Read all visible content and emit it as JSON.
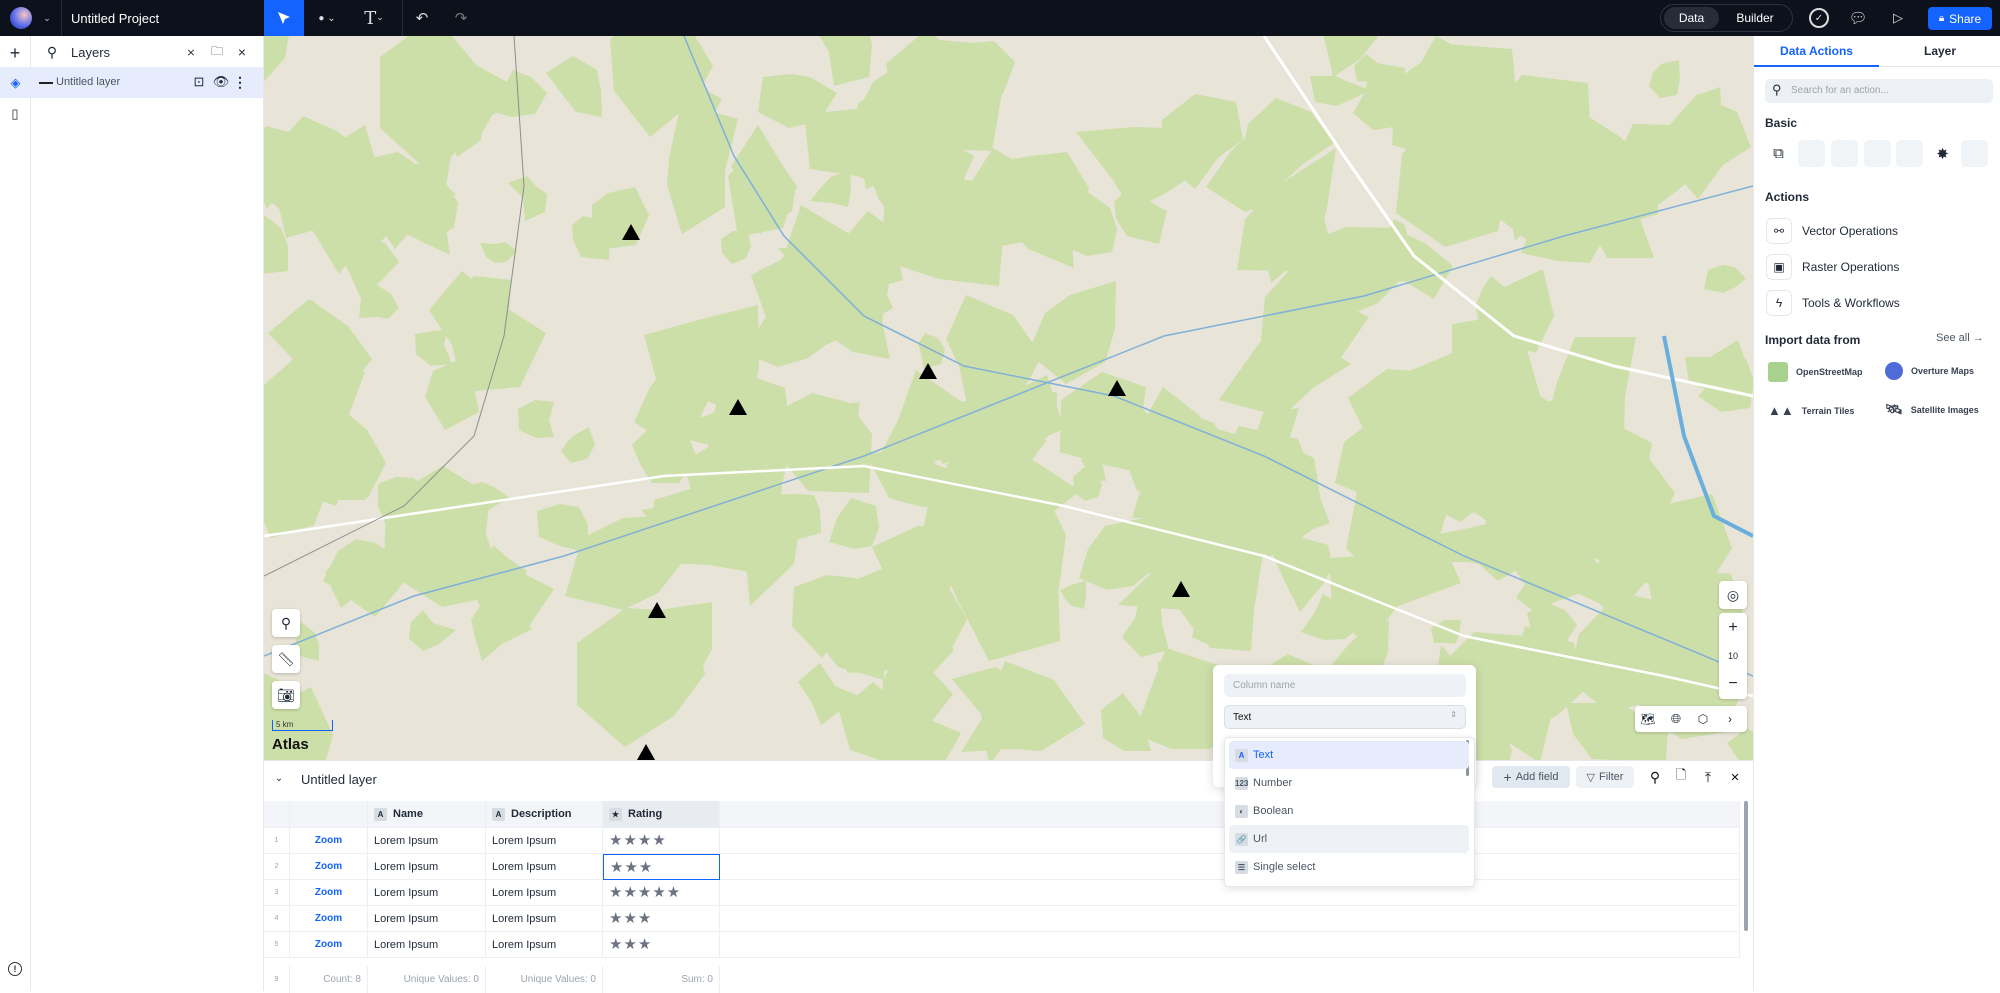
{
  "topbar": {
    "project_title": "Untitled Project",
    "mode_tabs": [
      "Data",
      "Builder"
    ],
    "active_mode": "Data",
    "share_label": "Share"
  },
  "layers_panel": {
    "title": "Layers",
    "layers": [
      {
        "name": "Untitled layer"
      }
    ]
  },
  "map": {
    "scale_label": "5 km",
    "attribution": "Atlas",
    "zoom_level": "10"
  },
  "right_panel": {
    "tabs": [
      "Data Actions",
      "Layer"
    ],
    "active_tab": "Data Actions",
    "search_placeholder": "Search for an action...",
    "basic_heading": "Basic",
    "actions_heading": "Actions",
    "actions": [
      "Vector Operations",
      "Raster Operations",
      "Tools & Workflows"
    ],
    "import_heading": "Import data from",
    "see_all": "See all →",
    "import_sources": [
      "OpenStreetMap",
      "Overture Maps",
      "Terrain Tiles",
      "Satellite Images"
    ]
  },
  "table": {
    "layer_name": "Untitled layer",
    "toolbar": {
      "add_field": "Add field",
      "filter": "Filter"
    },
    "columns": [
      {
        "type": "A",
        "name": "Name"
      },
      {
        "type": "A",
        "name": "Description"
      },
      {
        "type": "★",
        "name": "Rating"
      }
    ],
    "rows": [
      {
        "num": "1",
        "link": "Zoom",
        "name": "Lorem Ipsum",
        "description": "Lorem Ipsum",
        "rating": "★★★★"
      },
      {
        "num": "2",
        "link": "Zoom",
        "name": "Lorem Ipsum",
        "description": "Lorem Ipsum",
        "rating": "★★★"
      },
      {
        "num": "3",
        "link": "Zoom",
        "name": "Lorem Ipsum",
        "description": "Lorem Ipsum",
        "rating": "★★★★★"
      },
      {
        "num": "4",
        "link": "Zoom",
        "name": "Lorem Ipsum",
        "description": "Lorem Ipsum",
        "rating": "★★★"
      },
      {
        "num": "5",
        "link": "Zoom",
        "name": "Lorem Ipsum",
        "description": "Lorem Ipsum",
        "rating": "★★★"
      }
    ],
    "footer": {
      "num": "9",
      "count": "Count: 8",
      "name": "Unique Values: 0",
      "description": "Unique Values: 0",
      "rating": "Sum: 0"
    }
  },
  "add_field_popup": {
    "column_name_placeholder": "Column name",
    "type_value": "Text",
    "options": [
      {
        "icon": "A",
        "label": "Text"
      },
      {
        "icon": "123",
        "label": "Number"
      },
      {
        "icon": "◐",
        "label": "Boolean"
      },
      {
        "icon": "🔗",
        "label": "Url"
      },
      {
        "icon": "☰",
        "label": "Single select"
      }
    ],
    "selected": "Text"
  },
  "colors": {
    "accent": "#1463ff",
    "topbar": "#0d111b",
    "map_land": "#e8e4d8",
    "map_forest": "#cddfa8"
  }
}
